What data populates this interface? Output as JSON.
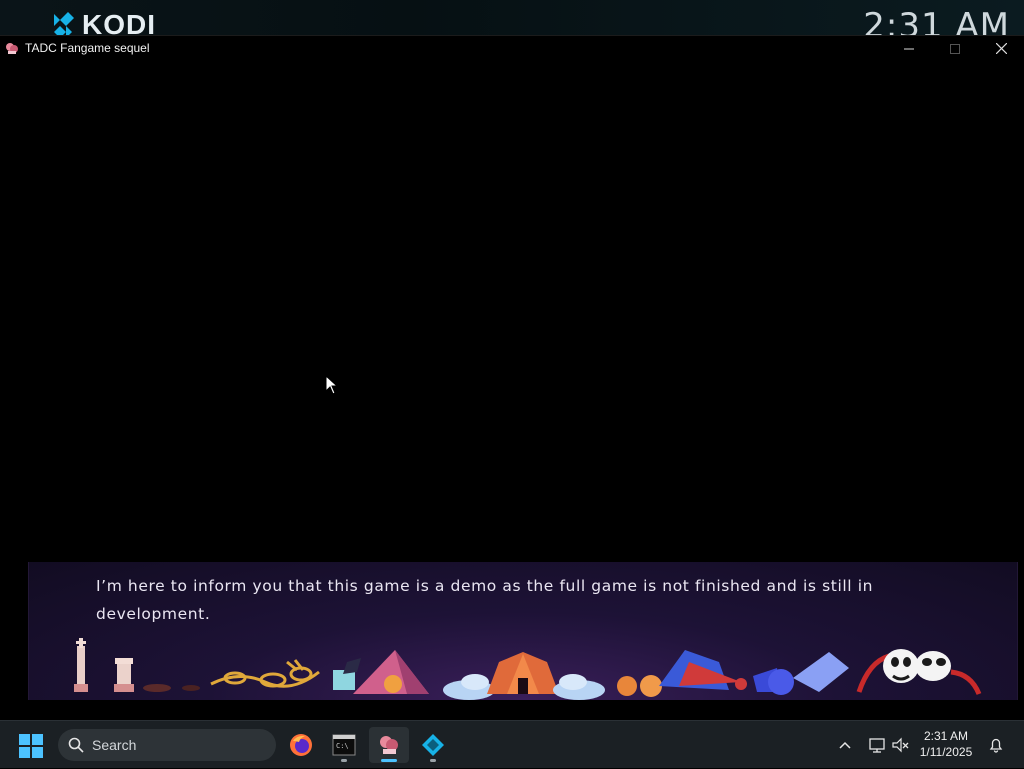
{
  "desktop": {
    "kodi_logo_text": "KODI",
    "kodi_clock": "2:31 AM"
  },
  "window": {
    "title": "TADC Fangame sequel",
    "controls": [
      "minimize",
      "maximize",
      "close"
    ]
  },
  "game": {
    "dialog_text": "I’m here to inform you that this game is a demo as the full game is not finished and is still in development.",
    "banner_colors": {
      "top": "#120c22",
      "glow": "#3a1f5a"
    }
  },
  "taskbar": {
    "search_label": "Search",
    "apps": [
      {
        "name": "firefox",
        "icon": "firefox-icon",
        "active": false,
        "running": false
      },
      {
        "name": "terminal",
        "icon": "terminal-icon",
        "active": false,
        "running": true
      },
      {
        "name": "tadc-fangame",
        "icon": "tadc-game-icon",
        "active": true,
        "running": true
      },
      {
        "name": "kodi",
        "icon": "kodi-icon",
        "active": false,
        "running": true
      }
    ],
    "tray": {
      "time": "2:31 AM",
      "date": "1/11/2025",
      "icons": [
        "chevron-up-icon",
        "network-icon",
        "volume-muted-icon",
        "notification-bell-icon"
      ]
    },
    "accent": "#4cc2ff"
  }
}
